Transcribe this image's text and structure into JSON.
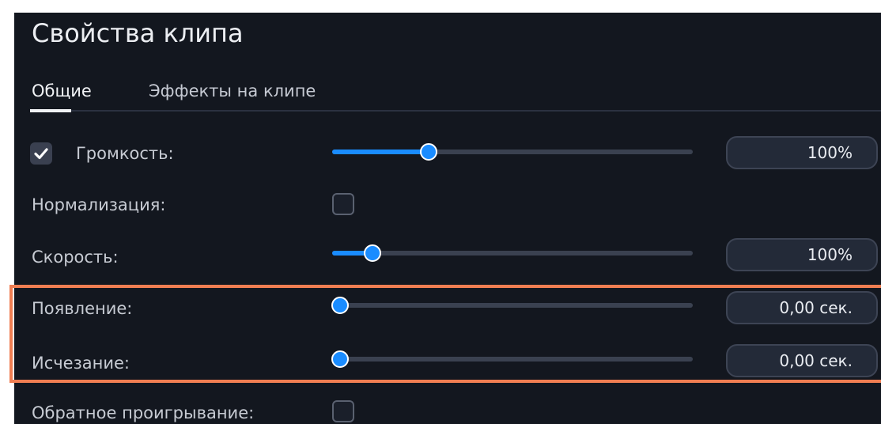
{
  "title": "Свойства клипа",
  "tabs": [
    {
      "label": "Общие",
      "active": true
    },
    {
      "label": "Эффекты на клипе",
      "active": false
    }
  ],
  "rows": {
    "volume": {
      "label": "Громкость:",
      "enabled": true,
      "slider_fraction": 0.265,
      "value": "100%"
    },
    "normalization": {
      "label": "Нормализация:",
      "checked": false
    },
    "speed": {
      "label": "Скорость:",
      "slider_fraction": 0.11,
      "value": "100%"
    },
    "fade_in": {
      "label": "Появление:",
      "slider_fraction": 0.02,
      "value": "0,00 сек."
    },
    "fade_out": {
      "label": "Исчезание:",
      "slider_fraction": 0.02,
      "value": "0,00 сек."
    },
    "reverse": {
      "label": "Обратное проигрывание:",
      "checked": false
    }
  },
  "colors": {
    "panel_bg": "#13171f",
    "accent": "#1a8cff",
    "highlight_border": "#f07e52",
    "text": "#c7cbd3"
  }
}
